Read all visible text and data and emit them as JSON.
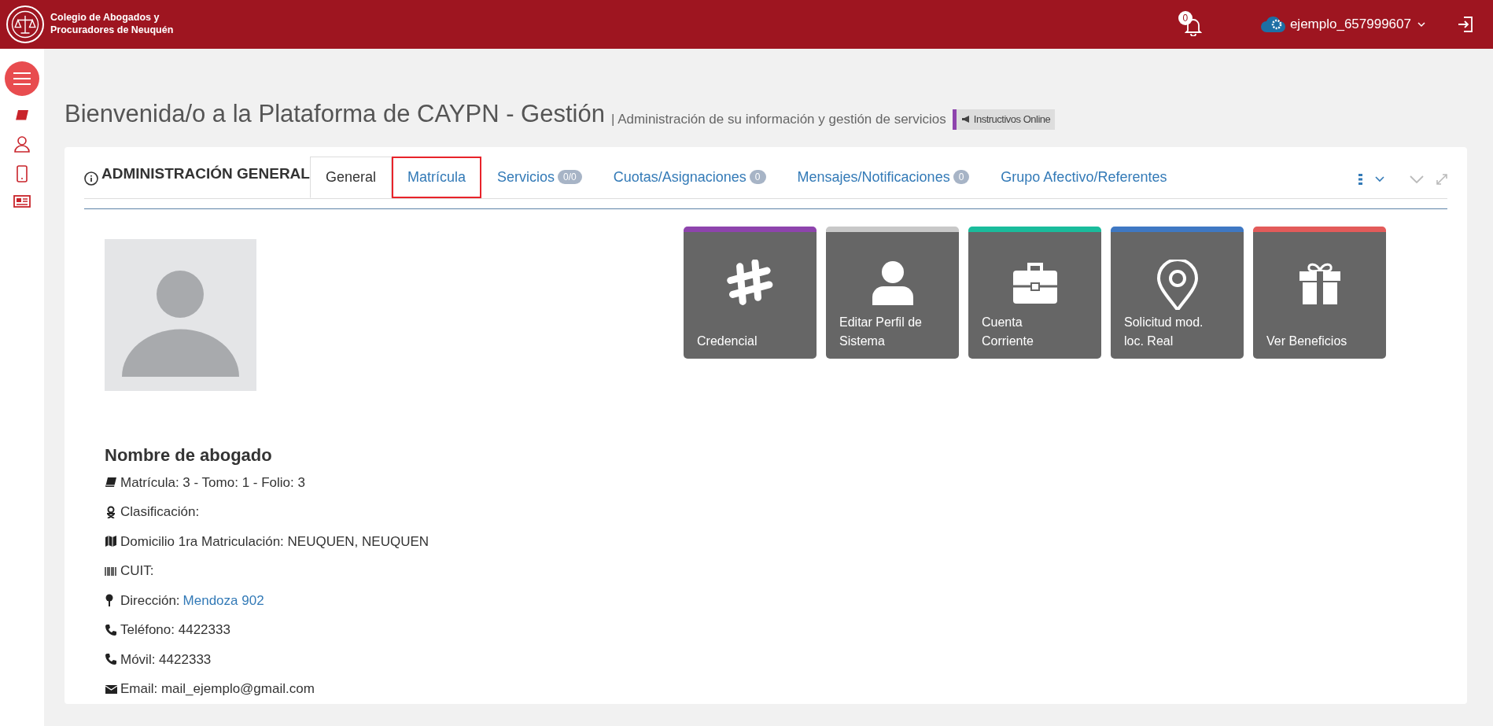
{
  "header": {
    "org_name_lines": [
      "Colegio de Abogados y",
      "Procuradores de Neuquén"
    ],
    "notifications_count": "0",
    "username": "ejemplo_657999607"
  },
  "page": {
    "title": "Bienvenida/o a la Plataforma de CAYPN - Gestión",
    "subtitle": "| Administración de su información y gestión de servicios",
    "help_badge": "Instructivos Online"
  },
  "panel": {
    "title": "ADMINISTRACIÓN GENERAL",
    "tabs": [
      {
        "label": "General",
        "selected": true,
        "highlighted": false
      },
      {
        "label": "Matrícula",
        "selected": false,
        "highlighted": true
      },
      {
        "label": "Servicios",
        "badge": "0/0",
        "selected": false,
        "highlighted": false
      },
      {
        "label": "Cuotas/Asignaciones",
        "badge": "0",
        "selected": false,
        "highlighted": false
      },
      {
        "label": "Mensajes/Notificaciones",
        "badge": "0",
        "selected": false,
        "highlighted": false
      },
      {
        "label": "Grupo Afectivo/Referentes",
        "selected": false,
        "highlighted": false
      }
    ]
  },
  "tiles": [
    {
      "kind": "hashtag",
      "label_lines": [
        "Credencial"
      ],
      "color": "#8e44ad"
    },
    {
      "kind": "user",
      "label_lines": [
        "Editar Perfil de",
        "Sistema"
      ],
      "color": "#c8c8c8"
    },
    {
      "kind": "briefcase",
      "label_lines": [
        "Cuenta",
        "Corriente"
      ],
      "color": "#1abc9c"
    },
    {
      "kind": "pin",
      "label_lines": [
        "Solicitud mod.",
        "loc. Real"
      ],
      "color": "#3f78c3"
    },
    {
      "kind": "gift",
      "label_lines": [
        "Ver Beneficios"
      ],
      "color": "#e35b5a"
    }
  ],
  "profile": {
    "name": "Nombre de abogado",
    "details": [
      {
        "kind": "book",
        "text": "Matrícula: 3 - Tomo: 1 - Folio: 3"
      },
      {
        "kind": "person",
        "text": "Clasificación:"
      },
      {
        "kind": "map",
        "text": "Domicilio 1ra Matriculación: NEUQUEN, NEUQUEN"
      },
      {
        "kind": "barcode",
        "text": "CUIT:"
      },
      {
        "kind": "pushpin",
        "text": "Dirección:",
        "link": "Mendoza 902"
      },
      {
        "kind": "phone",
        "text": "Teléfono: 4422333"
      },
      {
        "kind": "phone",
        "text": "Móvil: 4422333"
      },
      {
        "kind": "envelope",
        "text": "Email: mail_ejemplo@gmail.com"
      }
    ]
  }
}
